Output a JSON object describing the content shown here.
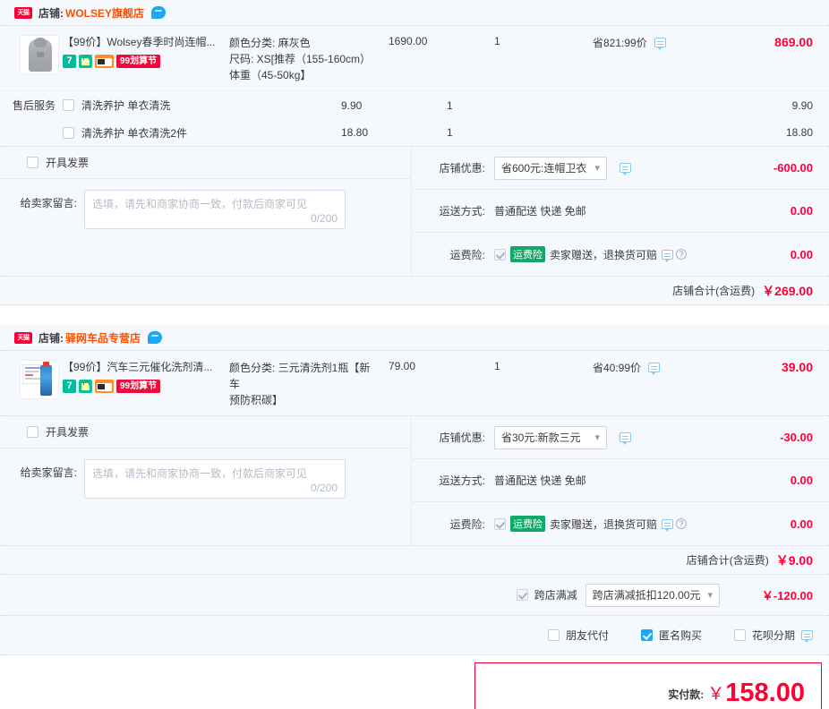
{
  "shops": [
    {
      "badge": "天猫",
      "shop_label": "店铺:",
      "shop_name": "WOLSEY旗舰店",
      "chat_icon": "chat-bubble-icon",
      "product": {
        "thumb": "hoodie-thumbnail",
        "title": "【99价】Wolsey春季时尚连帽...",
        "tags": [
          "7",
          "bag-icon",
          "card-icon",
          "99划算节"
        ],
        "sku_lines": [
          "颜色分类: 麻灰色",
          "尺码: XS[推荐（155-160cm）",
          "体重（45-50kg】"
        ],
        "price": "1690.00",
        "qty": "1",
        "promo": "省821:99价",
        "total": "869.00"
      },
      "services": {
        "label": "售后服务",
        "items": [
          {
            "name": "清洗养护 单衣清洗",
            "price": "9.90",
            "qty": "1",
            "total": "9.90",
            "checked": false
          },
          {
            "name": "清洗养护 单衣清洗2件",
            "price": "18.80",
            "qty": "1",
            "total": "18.80",
            "checked": false
          }
        ]
      },
      "invoice_label": "开具发票",
      "message": {
        "label": "给卖家留言:",
        "placeholder": "选填，请先和商家协商一致，付款后商家可见",
        "counter": "0/200",
        "value": ""
      },
      "coupon": {
        "label": "店铺优惠:",
        "selected": "省600元:连帽卫衣",
        "amount": "-600.00"
      },
      "shipping": {
        "label": "运送方式:",
        "text": "普通配送 快递 免邮",
        "amount": "0.00"
      },
      "freight_ins": {
        "label": "运费险:",
        "tag": "运费险",
        "text": "卖家赠送，退换货可赔",
        "amount": "0.00",
        "checked": true
      },
      "shop_total": {
        "label": "店铺合计(含运费)",
        "value": "￥269.00"
      }
    },
    {
      "badge": "天猫",
      "shop_label": "店铺:",
      "shop_name": "驿网车品专营店",
      "chat_icon": "chat-bubble-icon",
      "product": {
        "thumb": "cleaner-bottle-thumbnail",
        "title": "【99价】汽车三元催化洗剂清...",
        "tags": [
          "7",
          "bag-icon",
          "card-icon",
          "99划算节"
        ],
        "sku_lines": [
          "颜色分类: 三元清洗剂1瓶【新车",
          "预防积碳】"
        ],
        "price": "79.00",
        "qty": "1",
        "promo": "省40:99价",
        "total": "39.00"
      },
      "invoice_label": "开具发票",
      "message": {
        "label": "给卖家留言:",
        "placeholder": "选填，请先和商家协商一致，付款后商家可见",
        "counter": "0/200",
        "value": ""
      },
      "coupon": {
        "label": "店铺优惠:",
        "selected": "省30元:新款三元",
        "amount": "-30.00"
      },
      "shipping": {
        "label": "运送方式:",
        "text": "普通配送 快递 免邮",
        "amount": "0.00"
      },
      "freight_ins": {
        "label": "运费险:",
        "tag": "运费险",
        "text": "卖家赠送，退换货可赔",
        "amount": "0.00",
        "checked": true
      },
      "shop_total": {
        "label": "店铺合计(含运费)",
        "value": "￥9.00"
      }
    }
  ],
  "cross_shop": {
    "label": "跨店满减",
    "selected": "跨店满减抵扣120.00元",
    "amount": "￥-120.00",
    "checked": true
  },
  "pay_options": [
    {
      "label": "朋友代付",
      "checked": false,
      "has_tip": false
    },
    {
      "label": "匿名购买",
      "checked": true,
      "has_tip": false
    },
    {
      "label": "花呗分期",
      "checked": false,
      "has_tip": true
    }
  ],
  "final": {
    "label": "实付款:",
    "currency": "￥",
    "amount": "158.00"
  },
  "colors": {
    "accent_red": "#ff0036",
    "shop_name_orange": "#ff5000",
    "panel_bg": "#f5f8fd",
    "checkbox_blue": "#1ba8f5",
    "freight_green": "#0fa968"
  }
}
